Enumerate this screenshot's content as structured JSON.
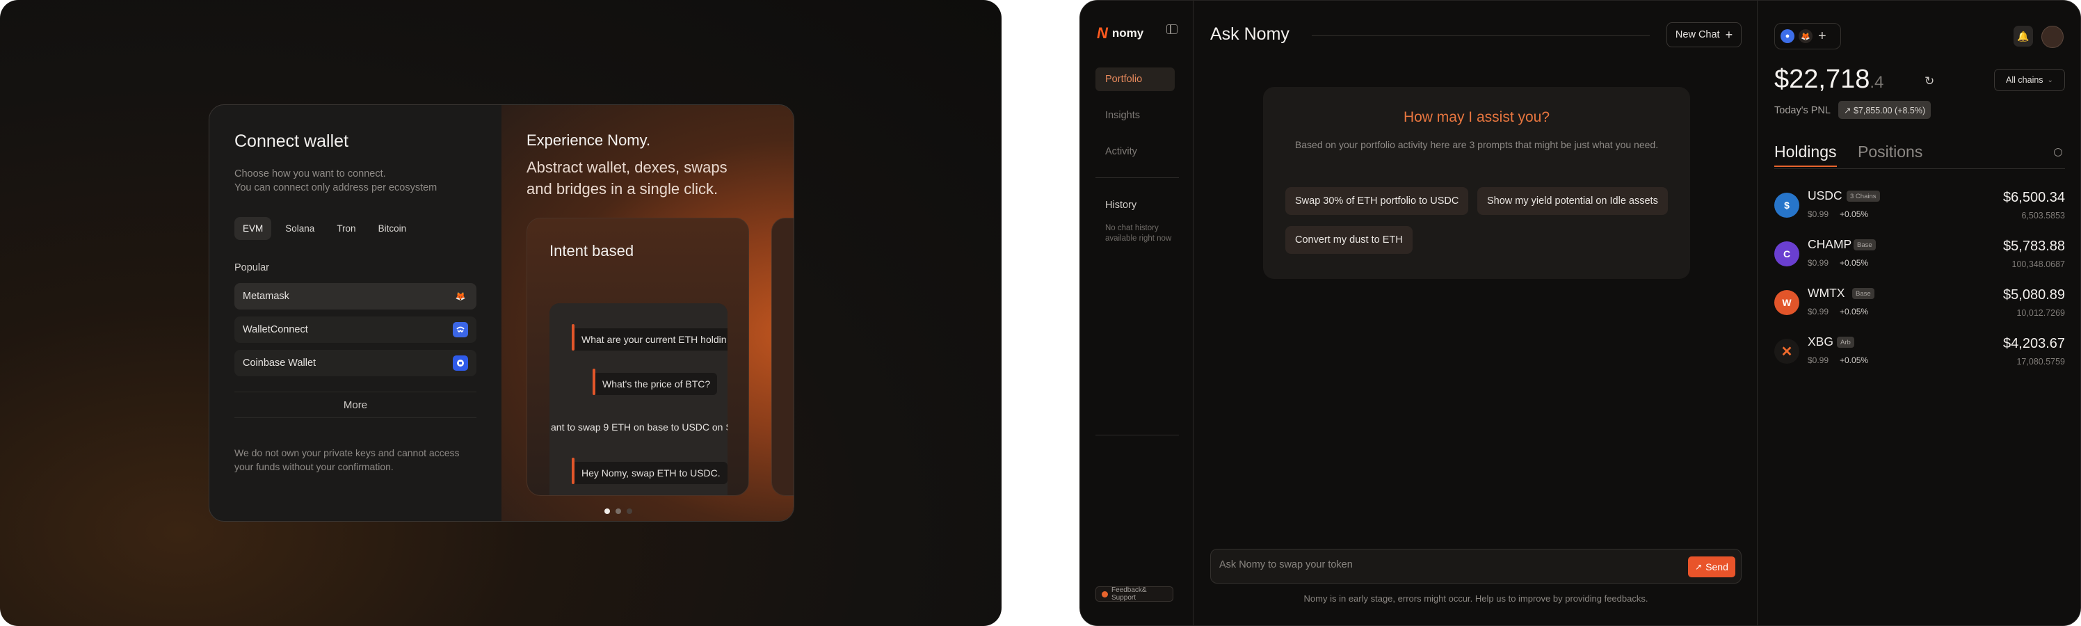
{
  "connect_modal": {
    "title": "Connect wallet",
    "subtitle_line1": "Choose how you want to connect.",
    "subtitle_line2": "You can connect only address per ecosystem",
    "ecosystems": [
      "EVM",
      "Solana",
      "Tron",
      "Bitcoin"
    ],
    "active_ecosystem": "EVM",
    "popular_label": "Popular",
    "wallets": [
      {
        "name": "Metamask",
        "icon": "metamask-icon"
      },
      {
        "name": "WalletConnect",
        "icon": "walletconnect-icon"
      },
      {
        "name": "Coinbase Wallet",
        "icon": "coinbase-icon"
      }
    ],
    "more_label": "More",
    "disclaimer_line1": "We do not own your private keys and cannot access",
    "disclaimer_line2": "your funds without your confirmation.",
    "promo": {
      "title": "Experience Nomy.",
      "subtitle": "Abstract wallet, dexes, swaps and bridges in a single click.",
      "card_title": "Intent based",
      "messages": [
        "What are your current ETH holdin",
        "What's the price of BTC?",
        "ant to swap 9 ETH on base to USDC on S",
        "Hey Nomy, swap ETH to USDC."
      ]
    }
  },
  "app": {
    "brand": "nomy",
    "nav": [
      "Portfolio",
      "Insights",
      "Activity"
    ],
    "active_nav": "Portfolio",
    "history_title": "History",
    "history_empty": "No chat history available right now",
    "feedback_label": "Feedback& Support",
    "page_title": "Ask Nomy",
    "new_chat_label": "New Chat",
    "assist_title": "How may I assist you?",
    "assist_subtitle": "Based on your portfolio activity here are 3 prompts that might be just what you need.",
    "prompts": [
      "Swap 30% of ETH portfolio to USDC",
      "Show my yield potential on Idle assets",
      "Convert my dust to ETH"
    ],
    "input_placeholder": "Ask Nomy to swap your token",
    "send_label": "Send",
    "footnote": "Nomy is in early stage, errors might occur. Help us to improve by providing feedbacks."
  },
  "portfolio": {
    "balance_main": "$22,718",
    "balance_cents": ".4",
    "chains_label": "All chains",
    "pnl_label": "Today's PNL",
    "pnl_value": "↗ $7,855.00 (+8.5%)",
    "tabs": [
      "Holdings",
      "Positions"
    ],
    "active_tab": "Holdings",
    "holdings": [
      {
        "symbol": "USDC",
        "badge": "3 Chains",
        "price": "$0.99",
        "change": "+0.05%",
        "usd": "$6,500.34",
        "amount": "6,503.5853",
        "color": "#2775ca"
      },
      {
        "symbol": "CHAMP",
        "badge": "Base",
        "price": "$0.99",
        "change": "+0.05%",
        "usd": "$5,783.88",
        "amount": "100,348.0687",
        "color": "#6a3fd0"
      },
      {
        "symbol": "WMTX",
        "badge": "Base",
        "price": "$0.99",
        "change": "+0.05%",
        "usd": "$5,080.89",
        "amount": "10,012.7269",
        "color": "#e2552a"
      },
      {
        "symbol": "XBG",
        "badge": "Arb",
        "price": "$0.99",
        "change": "+0.05%",
        "usd": "$4,203.67",
        "amount": "17,080.5759",
        "color": "#ef6a2c"
      }
    ]
  },
  "colors": {
    "accent": "#e9542a",
    "accent_text": "#e8763f"
  }
}
